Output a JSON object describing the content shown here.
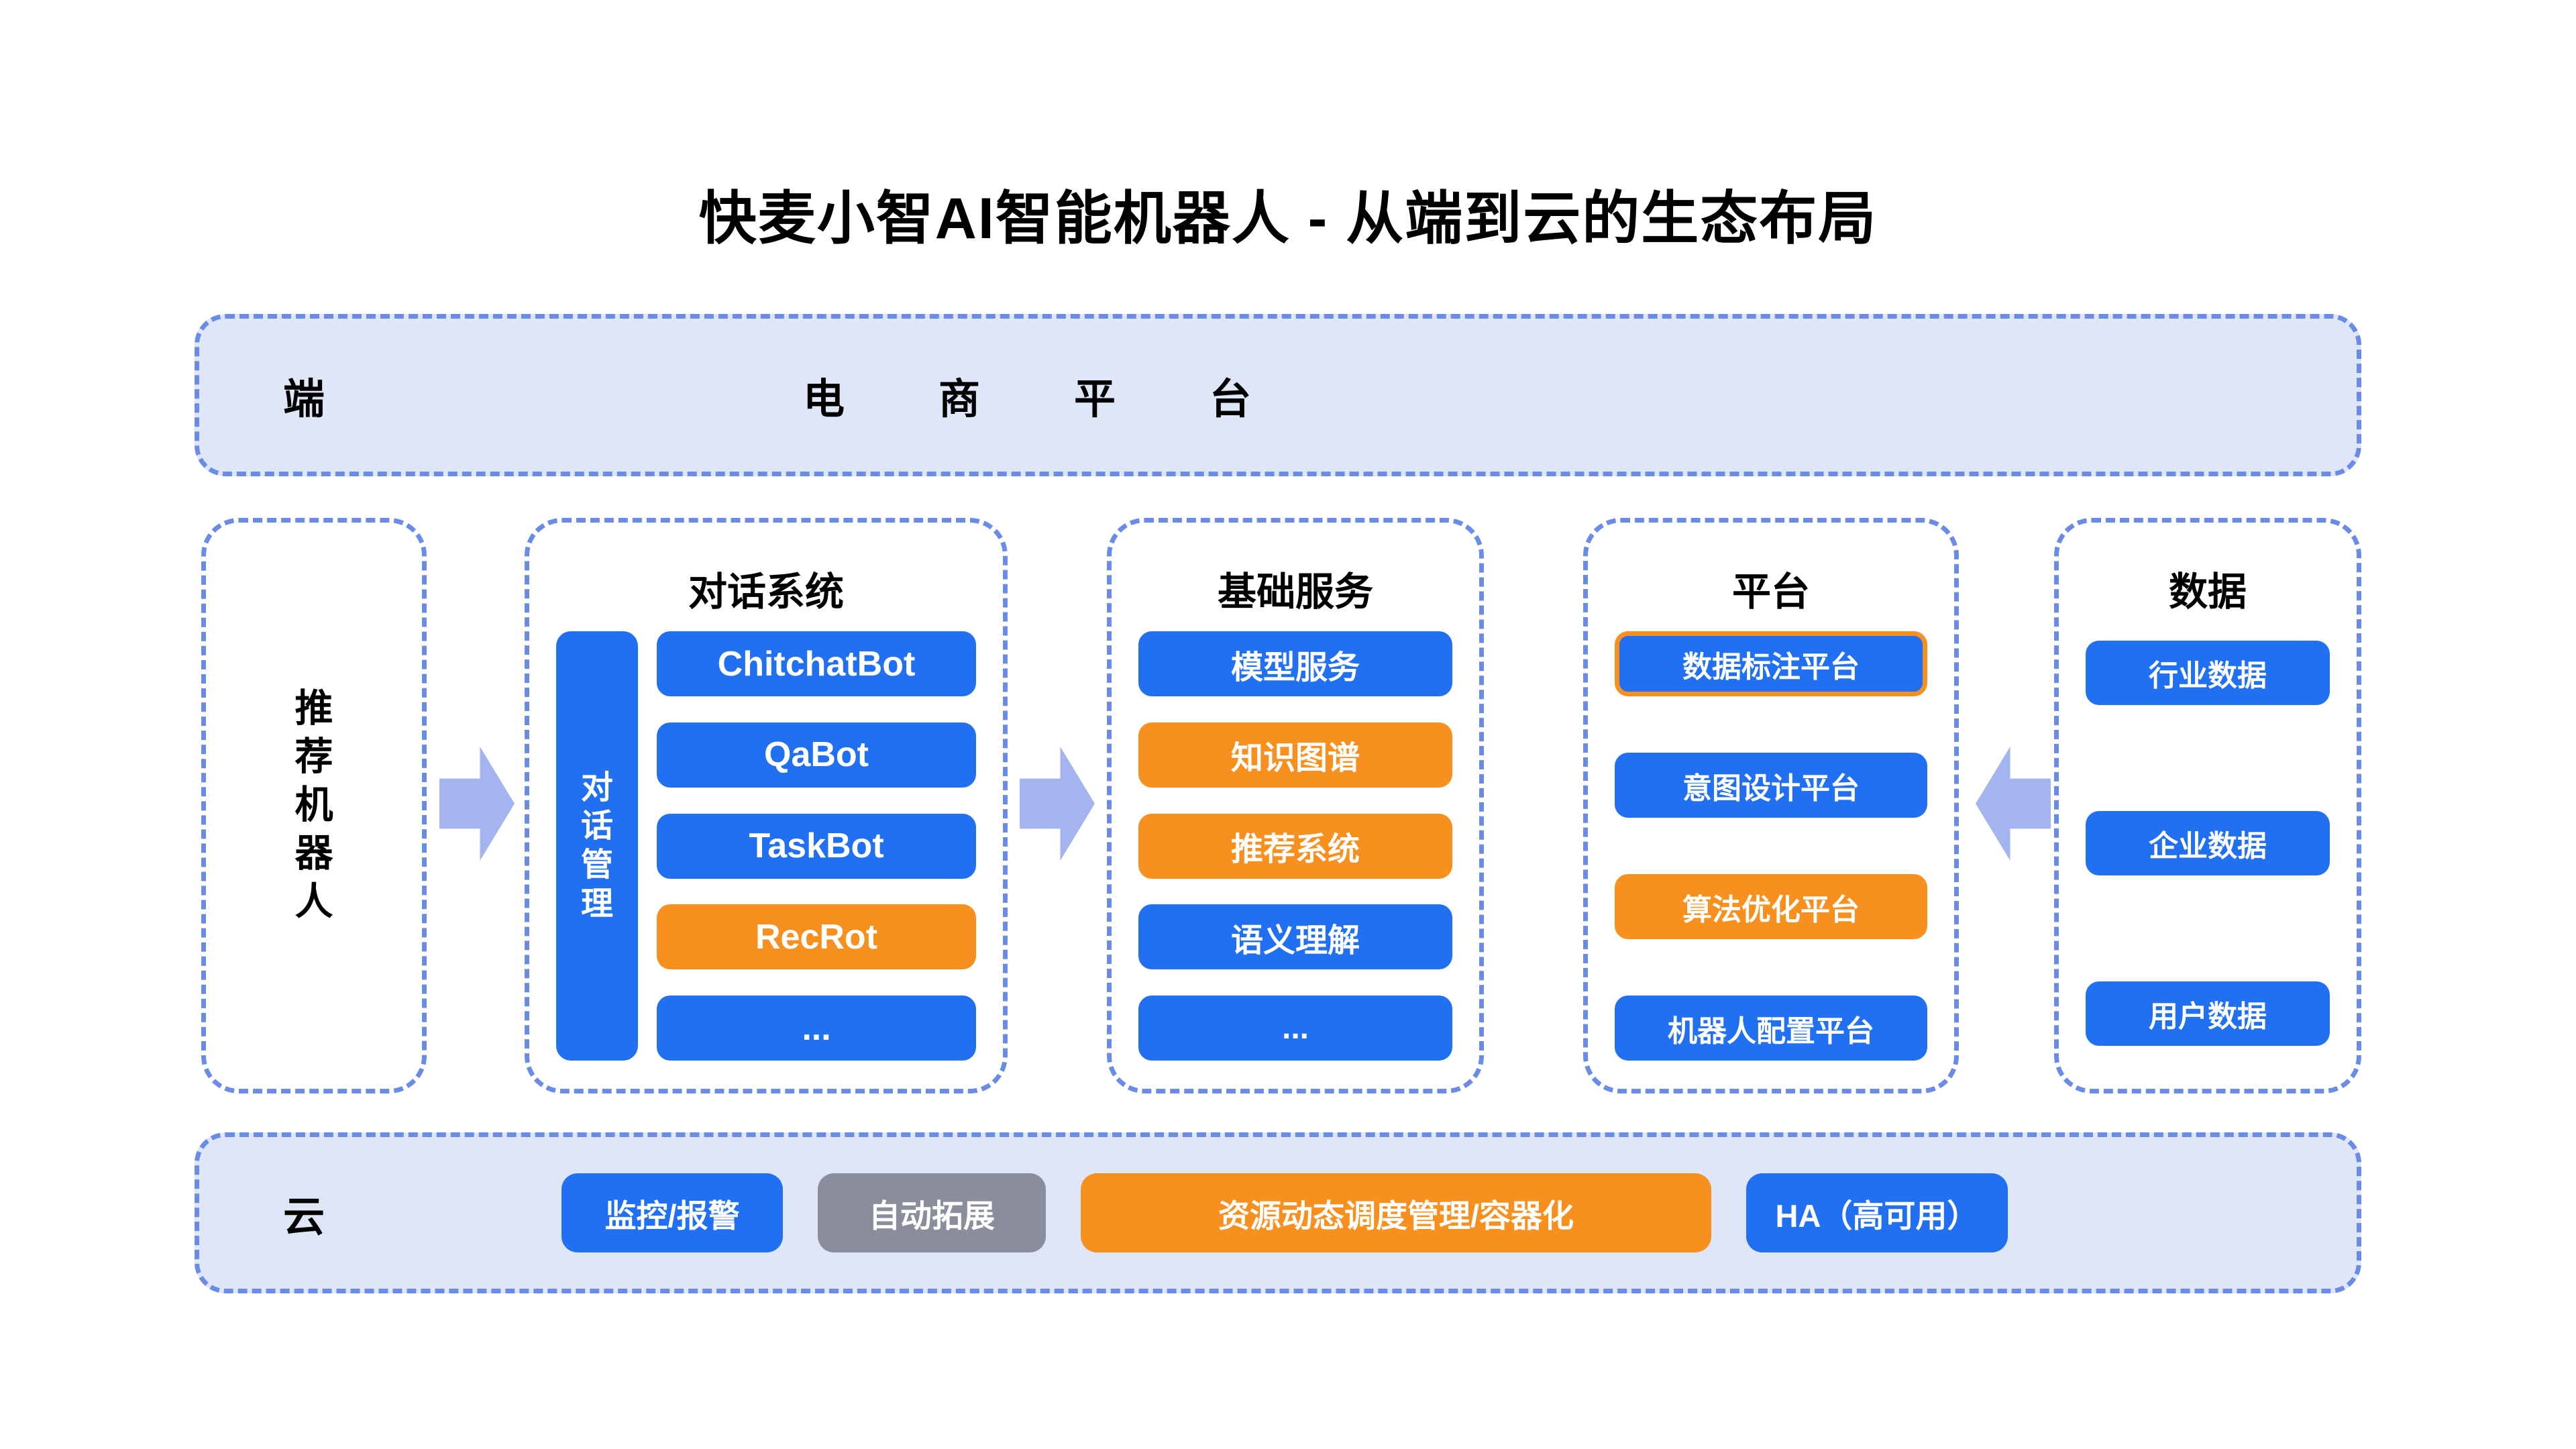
{
  "title": "快麦小智AI智能机器人 - 从端到云的生态布局",
  "bands": {
    "top": {
      "label": "端",
      "wide_text": "电商平台"
    },
    "bottom": {
      "label": "云",
      "chips": [
        {
          "label": "监控/报警",
          "color": "#2270f2",
          "style": "blue"
        },
        {
          "label": "自动拓展",
          "color": "#8a8d9a",
          "style": "gray"
        },
        {
          "label": "资源动态调度管理/容器化",
          "color": "#f7901e",
          "style": "orange"
        },
        {
          "label": "HA（高可用）",
          "color": "#2270f2",
          "style": "blue"
        }
      ]
    }
  },
  "columns": {
    "robot": {
      "vertical_label": [
        "推",
        "荐",
        "机",
        "器",
        "人"
      ]
    },
    "dialog": {
      "title": "对话系统",
      "manager": [
        "对",
        "话",
        "管",
        "理"
      ],
      "items": [
        {
          "label": "ChitchatBot",
          "color": "#2270f2"
        },
        {
          "label": "QaBot",
          "color": "#2270f2"
        },
        {
          "label": "TaskBot",
          "color": "#2270f2"
        },
        {
          "label": "RecRot",
          "color": "#f7901e"
        },
        {
          "label": "...",
          "color": "#2270f2"
        }
      ]
    },
    "basic": {
      "title": "基础服务",
      "items": [
        {
          "label": "模型服务",
          "color": "#2270f2"
        },
        {
          "label": "知识图谱",
          "color": "#f7901e"
        },
        {
          "label": "推荐系统",
          "color": "#f7901e"
        },
        {
          "label": "语义理解",
          "color": "#2270f2"
        },
        {
          "label": "...",
          "color": "#2270f2"
        }
      ]
    },
    "platform": {
      "title": "平台",
      "items": [
        {
          "label": "数据标注平台",
          "color": "#2270f2",
          "outline": "#f7901e"
        },
        {
          "label": "意图设计平台",
          "color": "#2270f2"
        },
        {
          "label": "算法优化平台",
          "color": "#f7901e"
        },
        {
          "label": "机器人配置平台",
          "color": "#2270f2"
        }
      ]
    },
    "data": {
      "title": "数据",
      "items": [
        {
          "label": "行业数据",
          "color": "#2270f2"
        },
        {
          "label": "企业数据",
          "color": "#2270f2"
        },
        {
          "label": "用户数据",
          "color": "#2270f2"
        }
      ]
    }
  },
  "arrows": [
    {
      "name": "robot-to-dialog",
      "direction": "right"
    },
    {
      "name": "dialog-to-basic",
      "direction": "right"
    },
    {
      "name": "data-to-platform",
      "direction": "left"
    }
  ],
  "palette": {
    "blue": "#2270f2",
    "orange": "#f7901e",
    "gray": "#8a8d9a",
    "band_fill": "#dee6f8",
    "dashed_border": "#6b8ce6",
    "arrow": "#a3b4ef"
  }
}
